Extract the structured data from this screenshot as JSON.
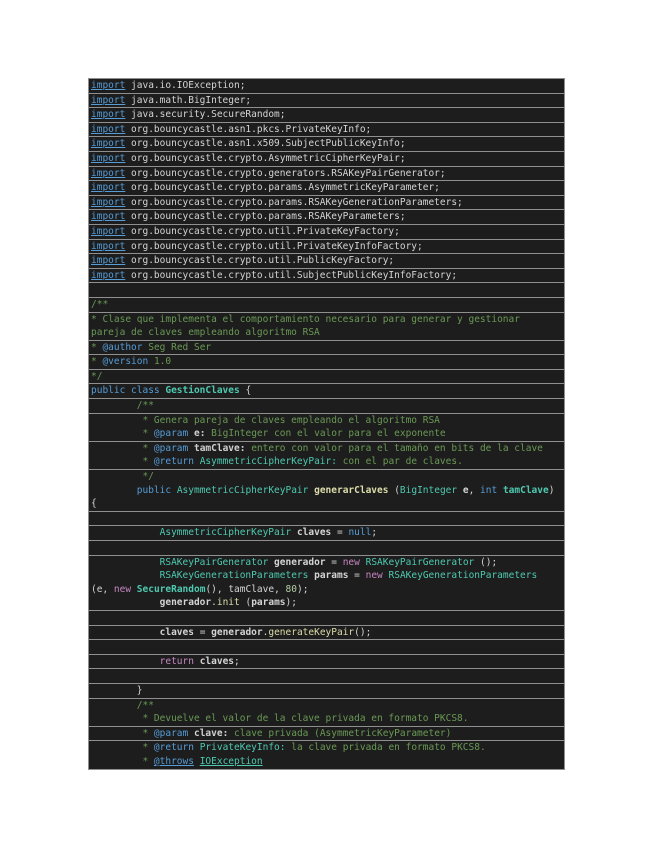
{
  "page": {
    "background": "#FFFFFF"
  },
  "code_block": {
    "background": "#1D1D1D",
    "line_border_color": "#8F8F8F",
    "language": "java"
  },
  "token_styles": {
    "kw": {
      "color": "#569CD6"
    },
    "kwu": {
      "color": "#569CD6",
      "underline": true
    },
    "ty": {
      "color": "#4EC9B0"
    },
    "tyb": {
      "color": "#4EC9B0",
      "bold": true
    },
    "tyu": {
      "color": "#4EC9B0",
      "underline": true
    },
    "fn": {
      "color": "#DCDCAA"
    },
    "fnb": {
      "color": "#DCDCAA",
      "bold": true
    },
    "va": {
      "color": "#D4D4D4",
      "bold": true
    },
    "pl": {
      "color": "#D4D4D4"
    },
    "cm": {
      "color": "#6A9955"
    },
    "tag": {
      "color": "#569CD6"
    },
    "tagu": {
      "color": "#569CD6",
      "underline": true
    },
    "pn": {
      "color": "#D0D0D0",
      "bold": true
    },
    "num": {
      "color": "#B5CEA8"
    },
    "ctl": {
      "color": "#C586C0"
    }
  },
  "code": {
    "boxes": [
      {
        "lines": [
          [
            {
              "t": "import",
              "c": "kwu"
            },
            {
              "t": " java.io.IOException;",
              "c": "pl"
            }
          ]
        ]
      },
      {
        "lines": [
          [
            {
              "t": "import",
              "c": "kwu"
            },
            {
              "t": " java.math.BigInteger;",
              "c": "pl"
            }
          ]
        ]
      },
      {
        "lines": [
          [
            {
              "t": "import",
              "c": "kwu"
            },
            {
              "t": " java.security.SecureRandom;",
              "c": "pl"
            }
          ]
        ]
      },
      {
        "lines": [
          [
            {
              "t": "import",
              "c": "kwu"
            },
            {
              "t": " org.bouncycastle.asn1.pkcs.PrivateKeyInfo;",
              "c": "pl"
            }
          ]
        ]
      },
      {
        "lines": [
          [
            {
              "t": "import",
              "c": "kwu"
            },
            {
              "t": " org.bouncycastle.asn1.x509.SubjectPublicKeyInfo;",
              "c": "pl"
            }
          ]
        ]
      },
      {
        "lines": [
          [
            {
              "t": "import",
              "c": "kwu"
            },
            {
              "t": " org.bouncycastle.crypto.AsymmetricCipherKeyPair;",
              "c": "pl"
            }
          ]
        ]
      },
      {
        "lines": [
          [
            {
              "t": "import",
              "c": "kwu"
            },
            {
              "t": " org.bouncycastle.crypto.generators.RSAKeyPairGenerator;",
              "c": "pl"
            }
          ]
        ]
      },
      {
        "lines": [
          [
            {
              "t": "import",
              "c": "kwu"
            },
            {
              "t": " org.bouncycastle.crypto.params.AsymmetricKeyParameter;",
              "c": "pl"
            }
          ]
        ]
      },
      {
        "lines": [
          [
            {
              "t": "import",
              "c": "kwu"
            },
            {
              "t": " org.bouncycastle.crypto.params.RSAKeyGenerationParameters;",
              "c": "pl"
            }
          ]
        ]
      },
      {
        "lines": [
          [
            {
              "t": "import",
              "c": "kwu"
            },
            {
              "t": " org.bouncycastle.crypto.params.RSAKeyParameters;",
              "c": "pl"
            }
          ]
        ]
      },
      {
        "lines": [
          [
            {
              "t": "import",
              "c": "kwu"
            },
            {
              "t": " org.bouncycastle.crypto.util.PrivateKeyFactory;",
              "c": "pl"
            }
          ]
        ]
      },
      {
        "lines": [
          [
            {
              "t": "import",
              "c": "kwu"
            },
            {
              "t": " org.bouncycastle.crypto.util.PrivateKeyInfoFactory;",
              "c": "pl"
            }
          ]
        ]
      },
      {
        "lines": [
          [
            {
              "t": "import",
              "c": "kwu"
            },
            {
              "t": " org.bouncycastle.crypto.util.PublicKeyFactory;",
              "c": "pl"
            }
          ]
        ]
      },
      {
        "lines": [
          [
            {
              "t": "import",
              "c": "kwu"
            },
            {
              "t": " org.bouncycastle.crypto.util.SubjectPublicKeyInfoFactory;",
              "c": "pl"
            }
          ]
        ]
      },
      {
        "lines": [
          []
        ]
      },
      {
        "lines": [
          [
            {
              "t": "/**",
              "c": "cm"
            }
          ]
        ]
      },
      {
        "lines": [
          [
            {
              "t": "* Clase que implementa el comportamiento necesario para generar y gestionar",
              "c": "cm"
            }
          ],
          [
            {
              "t": "pareja de claves empleando algoritmo RSA",
              "c": "cm"
            }
          ]
        ]
      },
      {
        "lines": [
          [
            {
              "t": "* ",
              "c": "cm"
            },
            {
              "t": "@author",
              "c": "tag"
            },
            {
              "t": " Seg Red Ser",
              "c": "cm"
            }
          ]
        ]
      },
      {
        "lines": [
          [
            {
              "t": "* ",
              "c": "cm"
            },
            {
              "t": "@version",
              "c": "tag"
            },
            {
              "t": " 1.0",
              "c": "cm"
            }
          ]
        ]
      },
      {
        "lines": [
          [
            {
              "t": "*/",
              "c": "cm"
            }
          ]
        ]
      },
      {
        "lines": [
          [
            {
              "t": "public class ",
              "c": "kw"
            },
            {
              "t": "GestionClaves",
              "c": "tyb"
            },
            {
              "t": " {",
              "c": "pl"
            }
          ]
        ]
      },
      {
        "lines": [
          [
            {
              "t": "        /**",
              "c": "cm"
            }
          ]
        ]
      },
      {
        "lines": [
          [
            {
              "t": "         * Genera pareja de claves empleando el algoritmo RSA",
              "c": "cm"
            }
          ],
          [
            {
              "t": "         * ",
              "c": "cm"
            },
            {
              "t": "@param",
              "c": "tag"
            },
            {
              "t": " ",
              "c": "cm"
            },
            {
              "t": "e:",
              "c": "pn"
            },
            {
              "t": " BigInteger con el valor para el exponente",
              "c": "cm"
            }
          ]
        ]
      },
      {
        "lines": [
          [
            {
              "t": "         * ",
              "c": "cm"
            },
            {
              "t": "@param",
              "c": "tag"
            },
            {
              "t": " ",
              "c": "cm"
            },
            {
              "t": "tamClave:",
              "c": "pn"
            },
            {
              "t": " entero con valor para el tamaño en bits de la clave",
              "c": "cm"
            }
          ],
          [
            {
              "t": "         * ",
              "c": "cm"
            },
            {
              "t": "@return",
              "c": "tag"
            },
            {
              "t": " ",
              "c": "cm"
            },
            {
              "t": "AsymmetricCipherKeyPair:",
              "c": "ty"
            },
            {
              "t": " con el par de claves.",
              "c": "cm"
            }
          ]
        ]
      },
      {
        "lines": [
          [
            {
              "t": "         */",
              "c": "cm"
            }
          ],
          [
            {
              "t": "        ",
              "c": "pl"
            },
            {
              "t": "public ",
              "c": "kw"
            },
            {
              "t": "AsymmetricCipherKeyPair",
              "c": "ty"
            },
            {
              "t": " ",
              "c": "pl"
            },
            {
              "t": "generarClaves",
              "c": "fnb"
            },
            {
              "t": " (",
              "c": "pl"
            },
            {
              "t": "BigInteger",
              "c": "ty"
            },
            {
              "t": " ",
              "c": "pl"
            },
            {
              "t": "e",
              "c": "va"
            },
            {
              "t": ", ",
              "c": "pl"
            },
            {
              "t": "int",
              "c": "kw"
            },
            {
              "t": " ",
              "c": "pl"
            },
            {
              "t": "tamClave",
              "c": "tyb"
            },
            {
              "t": ")",
              "c": "pl"
            }
          ],
          [
            {
              "t": "{",
              "c": "pl"
            }
          ]
        ]
      },
      {
        "lines": [
          []
        ]
      },
      {
        "lines": [
          [
            {
              "t": "            ",
              "c": "pl"
            },
            {
              "t": "AsymmetricCipherKeyPair",
              "c": "ty"
            },
            {
              "t": " ",
              "c": "pl"
            },
            {
              "t": "claves",
              "c": "va"
            },
            {
              "t": " = ",
              "c": "pl"
            },
            {
              "t": "null",
              "c": "kw"
            },
            {
              "t": ";",
              "c": "pl"
            }
          ]
        ]
      },
      {
        "lines": [
          []
        ]
      },
      {
        "lines": [
          [
            {
              "t": "            ",
              "c": "pl"
            },
            {
              "t": "RSAKeyPairGenerator",
              "c": "ty"
            },
            {
              "t": " ",
              "c": "pl"
            },
            {
              "t": "generador",
              "c": "va"
            },
            {
              "t": " = ",
              "c": "pl"
            },
            {
              "t": "new",
              "c": "ctl"
            },
            {
              "t": " ",
              "c": "pl"
            },
            {
              "t": "RSAKeyPairGenerator",
              "c": "ty"
            },
            {
              "t": " ();",
              "c": "pl"
            }
          ],
          [
            {
              "t": "            ",
              "c": "pl"
            },
            {
              "t": "RSAKeyGenerationParameters",
              "c": "ty"
            },
            {
              "t": " ",
              "c": "pl"
            },
            {
              "t": "params",
              "c": "va"
            },
            {
              "t": " = ",
              "c": "pl"
            },
            {
              "t": "new",
              "c": "ctl"
            },
            {
              "t": " ",
              "c": "pl"
            },
            {
              "t": "RSAKeyGenerationParameters",
              "c": "ty"
            }
          ],
          [
            {
              "t": "(e, ",
              "c": "pl"
            },
            {
              "t": "new",
              "c": "ctl"
            },
            {
              "t": " ",
              "c": "pl"
            },
            {
              "t": "SecureRandom",
              "c": "tyb"
            },
            {
              "t": "(), tamClave, ",
              "c": "pl"
            },
            {
              "t": "80",
              "c": "num"
            },
            {
              "t": ");",
              "c": "pl"
            }
          ],
          [
            {
              "t": "            ",
              "c": "pl"
            },
            {
              "t": "generador",
              "c": "va"
            },
            {
              "t": ".",
              "c": "pl"
            },
            {
              "t": "init",
              "c": "fn"
            },
            {
              "t": " (",
              "c": "pl"
            },
            {
              "t": "params",
              "c": "va"
            },
            {
              "t": ");",
              "c": "pl"
            }
          ]
        ]
      },
      {
        "lines": [
          []
        ]
      },
      {
        "lines": [
          [
            {
              "t": "            ",
              "c": "pl"
            },
            {
              "t": "claves",
              "c": "va"
            },
            {
              "t": " = ",
              "c": "pl"
            },
            {
              "t": "generador",
              "c": "va"
            },
            {
              "t": ".",
              "c": "pl"
            },
            {
              "t": "generateKeyPair",
              "c": "fn"
            },
            {
              "t": "();",
              "c": "pl"
            }
          ]
        ]
      },
      {
        "lines": [
          []
        ]
      },
      {
        "lines": [
          [
            {
              "t": "            ",
              "c": "pl"
            },
            {
              "t": "return",
              "c": "ctl"
            },
            {
              "t": " ",
              "c": "pl"
            },
            {
              "t": "claves",
              "c": "va"
            },
            {
              "t": ";",
              "c": "pl"
            }
          ]
        ]
      },
      {
        "lines": [
          []
        ]
      },
      {
        "lines": [
          [
            {
              "t": "        }",
              "c": "pl"
            }
          ]
        ]
      },
      {
        "lines": [
          [
            {
              "t": "        /**",
              "c": "cm"
            }
          ],
          [
            {
              "t": "         * Devuelve el valor de la clave privada en formato PKCS8.",
              "c": "cm"
            }
          ]
        ]
      },
      {
        "lines": [
          [
            {
              "t": "         * ",
              "c": "cm"
            },
            {
              "t": "@param",
              "c": "tag"
            },
            {
              "t": " ",
              "c": "cm"
            },
            {
              "t": "clave:",
              "c": "pn"
            },
            {
              "t": " clave privada (AsymmetricKeyParameter)",
              "c": "cm"
            }
          ]
        ]
      },
      {
        "lines": [
          [
            {
              "t": "         * ",
              "c": "cm"
            },
            {
              "t": "@return",
              "c": "tag"
            },
            {
              "t": " ",
              "c": "cm"
            },
            {
              "t": "PrivateKeyInfo:",
              "c": "ty"
            },
            {
              "t": " la clave privada en formato PKCS8.",
              "c": "cm"
            }
          ],
          [
            {
              "t": "         * ",
              "c": "cm"
            },
            {
              "t": "@throws",
              "c": "tagu"
            },
            {
              "t": " ",
              "c": "cm"
            },
            {
              "t": "IOException",
              "c": "tyu"
            }
          ]
        ]
      }
    ]
  }
}
